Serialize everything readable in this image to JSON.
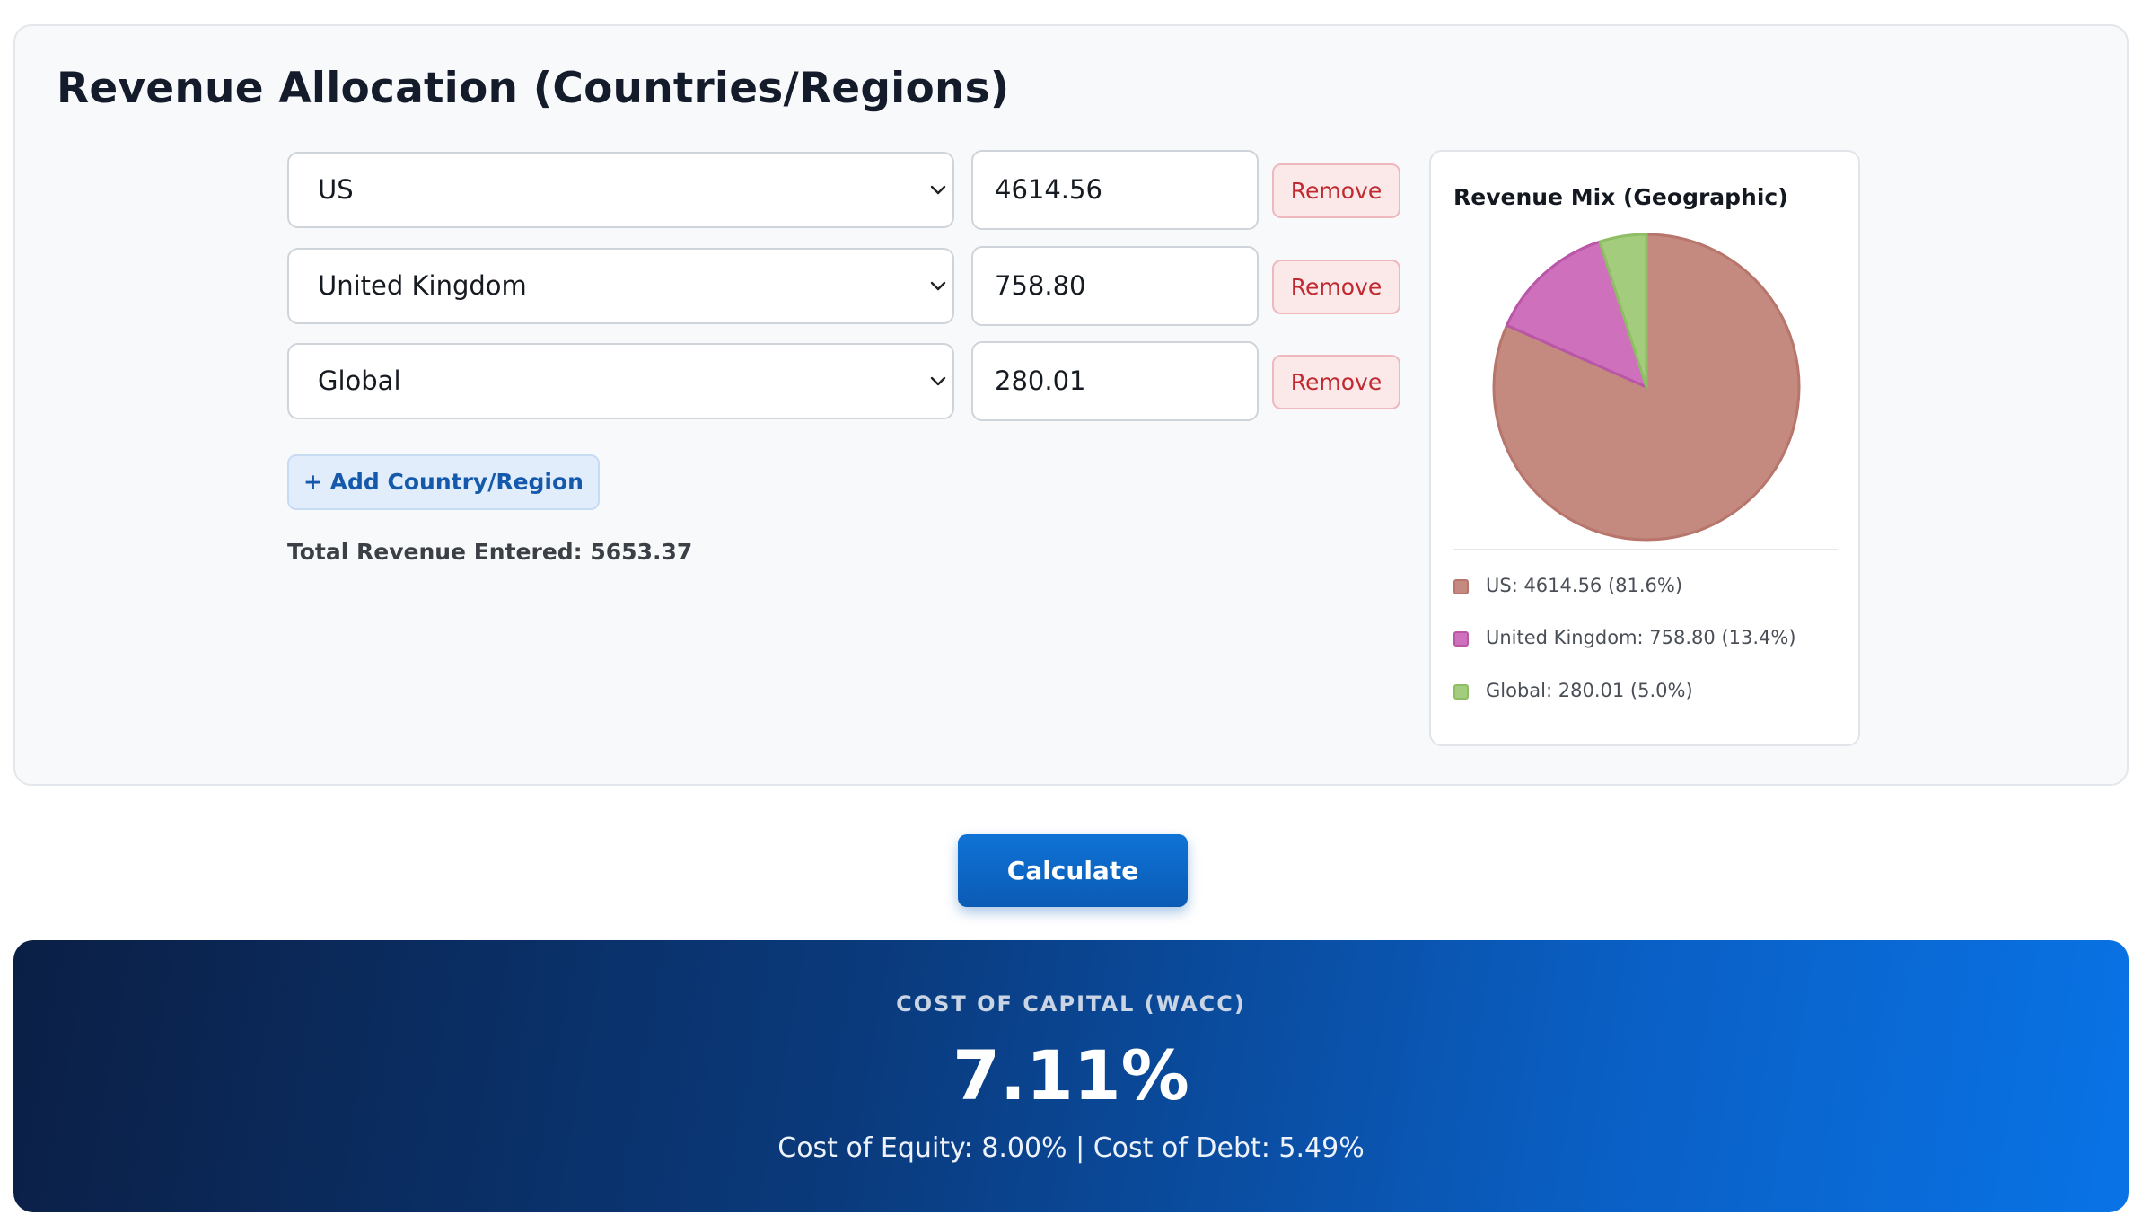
{
  "section": {
    "title": "Revenue Allocation (Countries/Regions)",
    "rows": [
      {
        "region": "US",
        "amount": "4614.56",
        "remove_label": "Remove"
      },
      {
        "region": "United Kingdom",
        "amount": "758.80",
        "remove_label": "Remove"
      },
      {
        "region": "Global",
        "amount": "280.01",
        "remove_label": "Remove"
      }
    ],
    "add_label": "+ Add Country/Region",
    "total_text": "Total Revenue Entered: 5653.37"
  },
  "chart_data": {
    "type": "pie",
    "title": "Revenue Mix (Geographic)",
    "categories": [
      "US",
      "United Kingdom",
      "Global"
    ],
    "values": [
      4614.56,
      758.8,
      280.01
    ],
    "percent": [
      81.6,
      13.4,
      5.0
    ],
    "colors": [
      "#c48a80",
      "#cf70bd",
      "#a3cd7d"
    ],
    "stroke_colors": [
      "#b8756b",
      "#b956a7",
      "#8fbd65"
    ],
    "legend": [
      "US: 4614.56 (81.6%)",
      "United Kingdom: 758.80 (13.4%)",
      "Global: 280.01 (5.0%)"
    ],
    "legend_position": "bottom"
  },
  "actions": {
    "calculate_label": "Calculate"
  },
  "result": {
    "label": "COST OF CAPITAL (WACC)",
    "value": "7.11%",
    "detail": "Cost of Equity: 8.00% | Cost of Debt: 5.49%"
  },
  "icons": {
    "dropdown": "chevron-down-icon"
  },
  "colors": {
    "accent": "#0b5bb5",
    "remove": "#c0292f",
    "result_dark": "#0b1f45",
    "result_light": "#0973e6"
  }
}
